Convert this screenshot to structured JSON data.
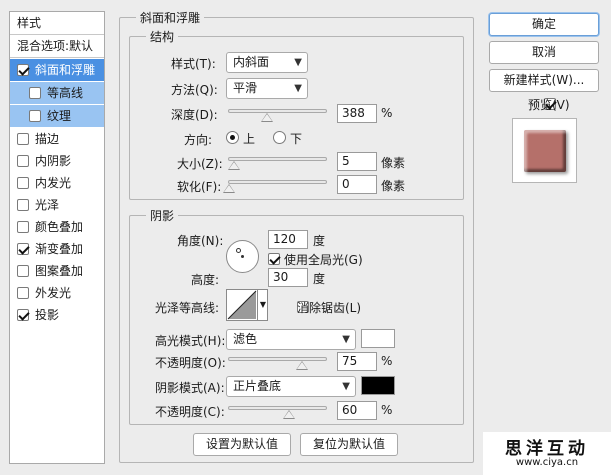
{
  "styles_panel": {
    "header": "样式",
    "blend": "混合选项:默认",
    "items": [
      {
        "label": "斜面和浮雕",
        "checked": true
      },
      {
        "label": "等高线",
        "checked": false
      },
      {
        "label": "纹理",
        "checked": false
      },
      {
        "label": "描边",
        "checked": false
      },
      {
        "label": "内阴影",
        "checked": false
      },
      {
        "label": "内发光",
        "checked": false
      },
      {
        "label": "光泽",
        "checked": false
      },
      {
        "label": "颜色叠加",
        "checked": false
      },
      {
        "label": "渐变叠加",
        "checked": true
      },
      {
        "label": "图案叠加",
        "checked": false
      },
      {
        "label": "外发光",
        "checked": false
      },
      {
        "label": "投影",
        "checked": true
      }
    ]
  },
  "bevel": {
    "title": "斜面和浮雕",
    "structure": {
      "title": "结构",
      "style_label": "样式(T):",
      "style_value": "内斜面",
      "technique_label": "方法(Q):",
      "technique_value": "平滑",
      "depth_label": "深度(D):",
      "depth_value": "388",
      "depth_unit": "%",
      "direction_label": "方向:",
      "dir_up": "上",
      "dir_down": "下",
      "size_label": "大小(Z):",
      "size_value": "5",
      "size_unit": "像素",
      "soften_label": "软化(F):",
      "soften_value": "0",
      "soften_unit": "像素"
    },
    "shading": {
      "title": "阴影",
      "angle_label": "角度(N):",
      "angle_value": "120",
      "angle_unit": "度",
      "global_light": "使用全局光(G)",
      "altitude_label": "高度:",
      "altitude_value": "30",
      "altitude_unit": "度",
      "gloss_label": "光泽等高线:",
      "anti_alias": "消除锯齿(L)",
      "highlight_mode_label": "高光模式(H):",
      "highlight_mode_value": "滤色",
      "highlight_color": "#ffffff",
      "highlight_opacity_label": "不透明度(O):",
      "highlight_opacity_value": "75",
      "highlight_opacity_unit": "%",
      "shadow_mode_label": "阴影模式(A):",
      "shadow_mode_value": "正片叠底",
      "shadow_color": "#000000",
      "shadow_opacity_label": "不透明度(C):",
      "shadow_opacity_value": "60",
      "shadow_opacity_unit": "%"
    },
    "make_default": "设置为默认值",
    "reset_default": "复位为默认值"
  },
  "side": {
    "ok": "确定",
    "cancel": "取消",
    "new_style": "新建样式(W)...",
    "preview": "预览(V)",
    "preview_color": "#b5706a"
  },
  "watermark": {
    "cn": "思洋互动",
    "url": "www.ciya.cn"
  }
}
